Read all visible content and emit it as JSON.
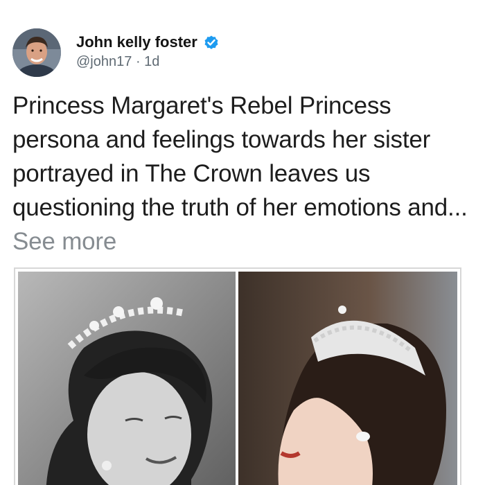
{
  "post": {
    "author": {
      "display_name": "John kelly foster",
      "handle": "@john17",
      "separator": "·",
      "time_ago": "1d",
      "verified": true,
      "verified_icon": "verified-badge-icon"
    },
    "text": "Princess Margaret's Rebel Princess persona and feelings towards her sister portrayed in The Crown leaves us questioning the truth of her emotions and...",
    "see_more": "See more"
  },
  "media": {
    "images": [
      {
        "name": "black-and-white-photo-of-woman-wearing-tiara"
      },
      {
        "name": "color-photo-of-actress-wearing-tiara"
      }
    ]
  },
  "colors": {
    "verified_blue": "#1d9bf0",
    "text": "#1d1d1d",
    "secondary_text": "#5f6a73",
    "see_more": "#868c91",
    "media_border": "#d7d7d7"
  }
}
